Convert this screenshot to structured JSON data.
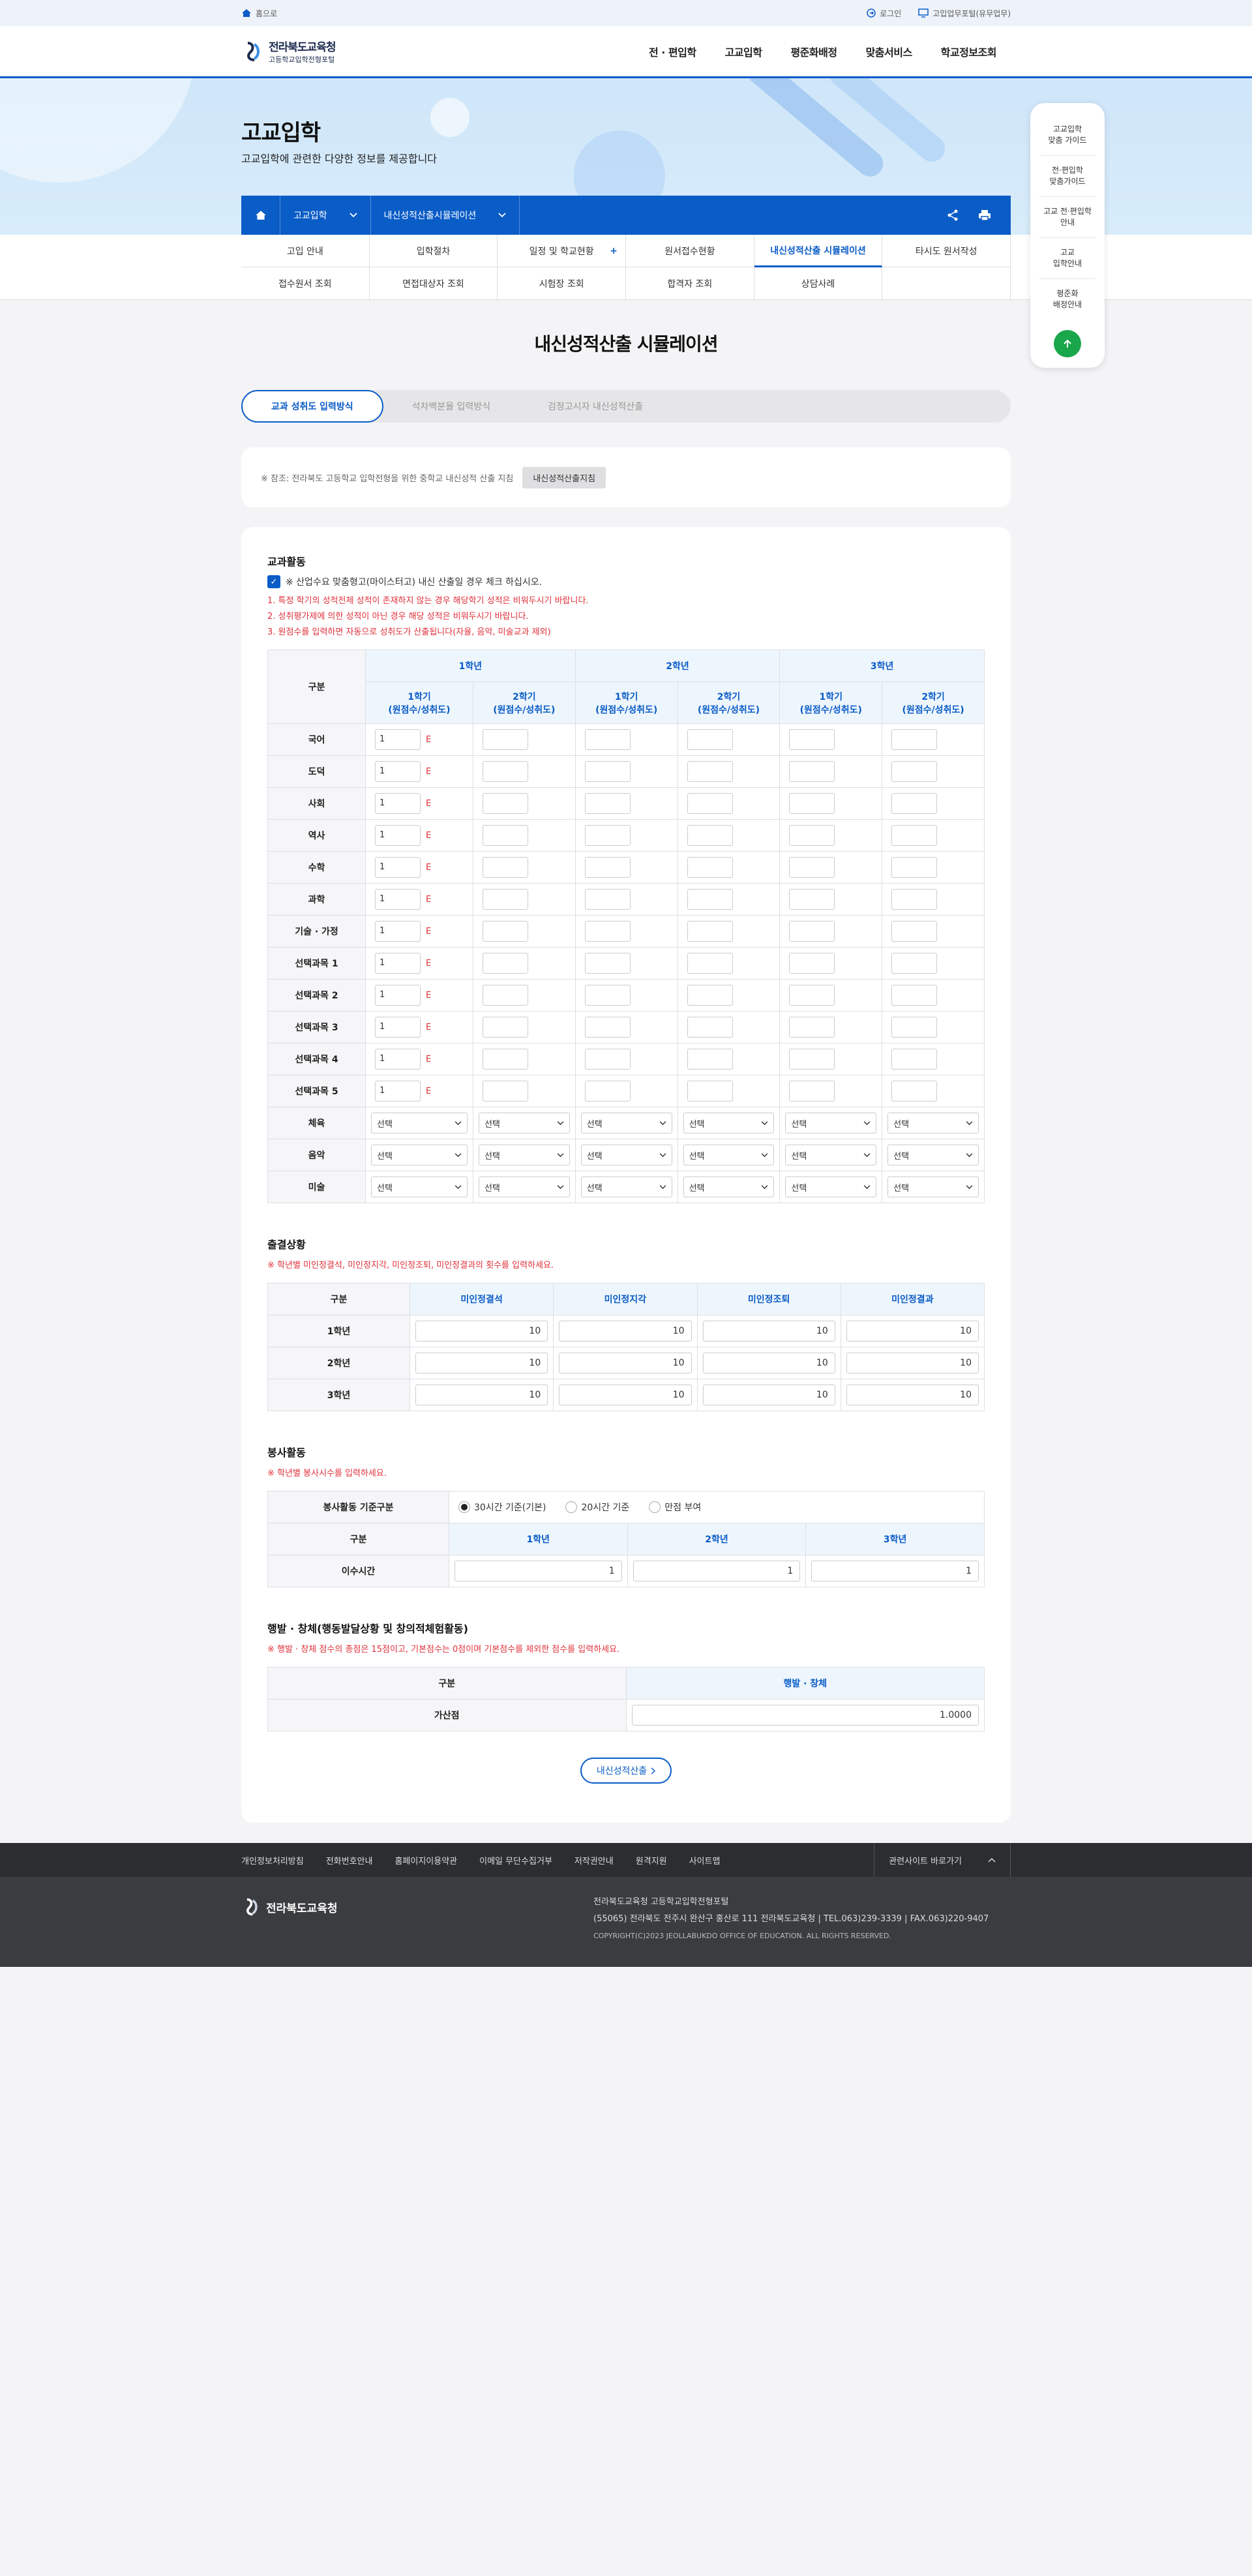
{
  "util": {
    "home": "홈으로",
    "login": "로그인",
    "call": "고입업무포털(유무업무)"
  },
  "header": {
    "logo_l1": "전라북도교육청",
    "logo_l2": "고등학교입학전형포털",
    "gnb": [
      "전 · 편입학",
      "고교입학",
      "평준화배정",
      "맞춤서비스",
      "학교정보조회"
    ]
  },
  "visual": {
    "title": "고교입학",
    "desc": "고교입학에 관련한 다양한 정보를 제공합니다"
  },
  "location": {
    "depth1": "고교입학",
    "depth2": "내신성적산출시뮬레이션"
  },
  "submenu": [
    "고입 안내",
    "입학절차",
    "일정 및 학교현황",
    "원서접수현황",
    "내신성적산출 시뮬레이션",
    "타시도 원서작성",
    "접수원서 조회",
    "면접대상자 조회",
    "시험장 조회",
    "합격자 조회",
    "상담사례",
    ""
  ],
  "quick": [
    "고교입학\n맞춤 가이드",
    "전·편입학\n맞춤가이드",
    "고교 전·편입학\n안내",
    "고교\n입학안내",
    "평준화\n배정안내"
  ],
  "page": {
    "title": "내신성적산출 시뮬레이션"
  },
  "tabs": [
    "교과 성취도 입력방식",
    "석차백분율 입력방식",
    "검정고시자 내신성적산출"
  ],
  "note": {
    "text": "※ 참조: 전라북도 고등학교 입학전형을 위한 중학교 내신성적 산출 지침",
    "btn": "내신성적산출지침"
  },
  "subject": {
    "title": "교과활동",
    "check_label": "※ 산업수요 맞춤형고(마이스터고) 내신 산출일 경우 체크 하십시오.",
    "notes": [
      "1. 특정 학기의 성적전체 성적이 존재하지 않는 경우 해당학기 성적은 비워두시기 바랍니다.",
      "2. 성취평가제에 의한 성적이 아닌 경우 해당 성적은 비워두시기 바랍니다.",
      "3. 원점수를 입력하면 자동으로 성취도가 산출됩니다(자율, 음악, 미술교과 제외)"
    ],
    "head_gubun": "구분",
    "years": [
      "1학년",
      "2학년",
      "3학년"
    ],
    "terms": [
      [
        "1학기",
        "(원점수/성취도)"
      ],
      [
        "2학기",
        "(원점수/성취도)"
      ],
      [
        "1학기",
        "(원점수/성취도)"
      ],
      [
        "2학기",
        "(원점수/성취도)"
      ],
      [
        "1학기",
        "(원점수/성취도)"
      ],
      [
        "2학기",
        "(원점수/성취도)"
      ]
    ],
    "score_rows": [
      "국어",
      "도덕",
      "사회",
      "역사",
      "수학",
      "과학",
      "기술 · 가정",
      "선택과목 1",
      "선택과목 2",
      "선택과목 3",
      "선택과목 4",
      "선택과목 5"
    ],
    "score_value": "1",
    "grade_value": "E",
    "select_rows": [
      "체육",
      "음악",
      "미술"
    ],
    "select_label": "선택"
  },
  "attendance": {
    "title": "출결상황",
    "note": "※ 학년별 미인정결석, 미인정지각, 미인정조퇴, 미인정결과의 횟수를 입력하세요.",
    "head_gubun": "구분",
    "cols": [
      "미인정결석",
      "미인정지각",
      "미인정조퇴",
      "미인정결과"
    ],
    "rows": [
      {
        "label": "1학년",
        "values": [
          "10",
          "10",
          "10",
          "10"
        ]
      },
      {
        "label": "2학년",
        "values": [
          "10",
          "10",
          "10",
          "10"
        ]
      },
      {
        "label": "3학년",
        "values": [
          "10",
          "10",
          "10",
          "10"
        ]
      }
    ]
  },
  "volunteer": {
    "title": "봉사활동",
    "note": "※ 학년별 봉사시수를 입력하세요.",
    "basis_label": "봉사활동 기준구분",
    "options": [
      "30시간 기준(기본)",
      "20시간 기준",
      "만점 부여"
    ],
    "head_gubun": "구분",
    "cols": [
      "1학년",
      "2학년",
      "3학년"
    ],
    "row_label": "이수시간",
    "values": [
      "1",
      "1",
      "1"
    ]
  },
  "behavior": {
    "title": "행발 · 창체(행동발달상황 및 창의적체험활동)",
    "note": "※ 행발 · 창체 점수의 총점은 15점이고, 기본점수는 0점이며 기본점수를 제외한 점수를 입력하세요.",
    "head_gubun": "구분",
    "col": "행발 · 창체",
    "row_label": "가산점",
    "value": "1.0000"
  },
  "calc_button": "내신성적산출",
  "footer": {
    "links": [
      "개인정보처리방침",
      "전화번호안내",
      "홈페이지이용약관",
      "이메일 무단수집거부",
      "저작권안내",
      "원격지원",
      "사이트맵"
    ],
    "related": "관련사이트 바로가기",
    "logo": "전라북도교육청",
    "line1": "전라북도교육청 고등학교입학전형포털",
    "line2": "(55065) 전라북도 전주시 완산구 홍산로 111 전라북도교육청   |   TEL.063)239-3339   |   FAX.063)220-9407",
    "copy": "COPYRIGHT(C)2023 JEOLLABUKDO OFFICE OF EDUCATION. ALL RIGHTS RESERVED."
  },
  "colors": {
    "primary": "#0a5cc7",
    "accent_red": "#e0313a",
    "top_button": "#1aa64a"
  }
}
